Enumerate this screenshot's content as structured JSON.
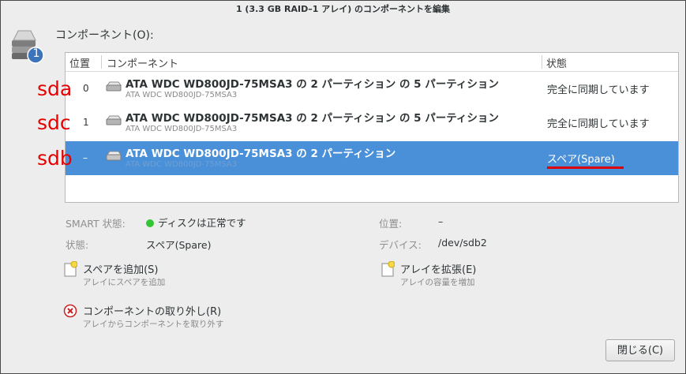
{
  "window": {
    "title": "1 (3.3 GB RAID–1 アレイ) のコンポーネントを編集"
  },
  "section_label": "コンポーネント(O):",
  "array_icon_badge": "1",
  "table": {
    "columns": [
      "位置",
      "コンポーネント",
      "状態"
    ],
    "rows": [
      {
        "annotation": "sda",
        "position": "0",
        "title": "ATA WDC WD800JD-75MSA3 の 2 パーティション の 5 パーティション",
        "subtitle": "ATA WDC WD800JD-75MSA3",
        "state": "完全に同期しています",
        "selected": false
      },
      {
        "annotation": "sdc",
        "position": "1",
        "title": "ATA WDC WD800JD-75MSA3 の 2 パーティション の 5 パーティション",
        "subtitle": "ATA WDC WD800JD-75MSA3",
        "state": "完全に同期しています",
        "selected": false
      },
      {
        "annotation": "sdb",
        "position": "–",
        "title": "ATA WDC WD800JD-75MSA3 の 2 パーティション",
        "subtitle": "ATA WDC WD800JD-75MSA3",
        "state": "スペア(Spare)",
        "selected": true
      }
    ]
  },
  "info": {
    "smart_label": "SMART 状態:",
    "smart_value": "ディスクは正常です",
    "smart_color": "#34c534",
    "state_label": "状態:",
    "state_value": "スペア(Spare)",
    "position_label": "位置:",
    "position_value": "–",
    "device_label": "デバイス:",
    "device_value": "/dev/sdb2"
  },
  "actions": {
    "add_spare": {
      "title": "スペアを追加(S)",
      "subtitle": "アレイにスペアを追加"
    },
    "expand_array": {
      "title": "アレイを拡張(E)",
      "subtitle": "アレイの容量を増加"
    },
    "remove_component": {
      "title": "コンポーネントの取り外し(R)",
      "subtitle": "アレイからコンポーネントを取り外す"
    }
  },
  "close_button": "閉じる(C)",
  "colors": {
    "selection": "#4a90d9",
    "annotation": "#e60000",
    "underline": "#dd0000"
  }
}
